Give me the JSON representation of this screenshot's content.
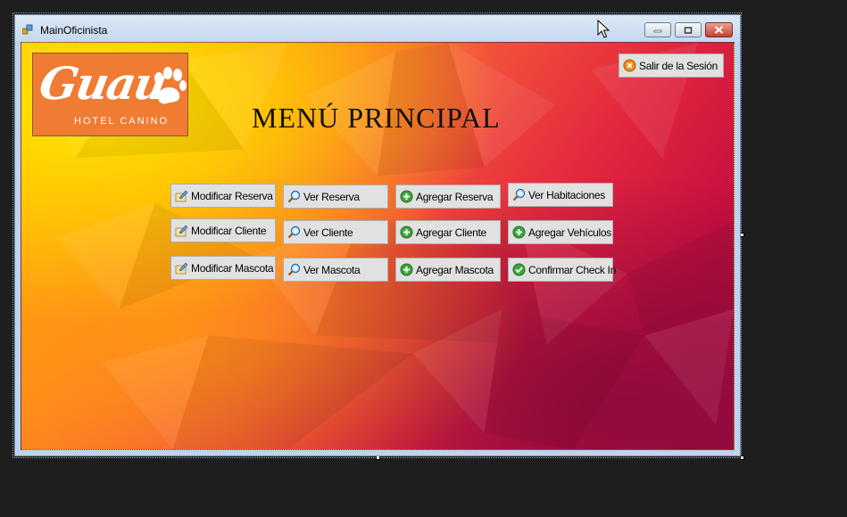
{
  "window": {
    "title": "MainOficinista"
  },
  "header": {
    "title": "MENÚ PRINCIPAL",
    "logout_label": "Salir de la Sesión"
  },
  "logo": {
    "brand": "Guau",
    "tagline": "HOTEL CANINO"
  },
  "menu": {
    "modificar_reserva": "Modificar Reserva",
    "modificar_cliente": "Modificar Cliente",
    "modificar_mascota": "Modificar Mascota",
    "ver_reserva": "Ver Reserva",
    "ver_cliente": "Ver Cliente",
    "ver_mascota": "Ver Mascota",
    "agregar_reserva": "Agregar Reserva",
    "agregar_cliente": "Agregar Cliente",
    "agregar_mascota": "Agregar Mascota",
    "ver_habitaciones": "Ver Habitaciones",
    "agregar_vehiculos": "Agregar Vehículos",
    "confirmar_checkin": "Confirmar Check In"
  },
  "colors": {
    "logo_bg": "#f07b32",
    "button_bg": "#e1e1e1",
    "accent_green": "#3aa63a",
    "close_red": "#c4402b"
  },
  "icons": [
    "edit-icon",
    "search-icon",
    "add-icon",
    "check-icon",
    "logout-icon"
  ]
}
